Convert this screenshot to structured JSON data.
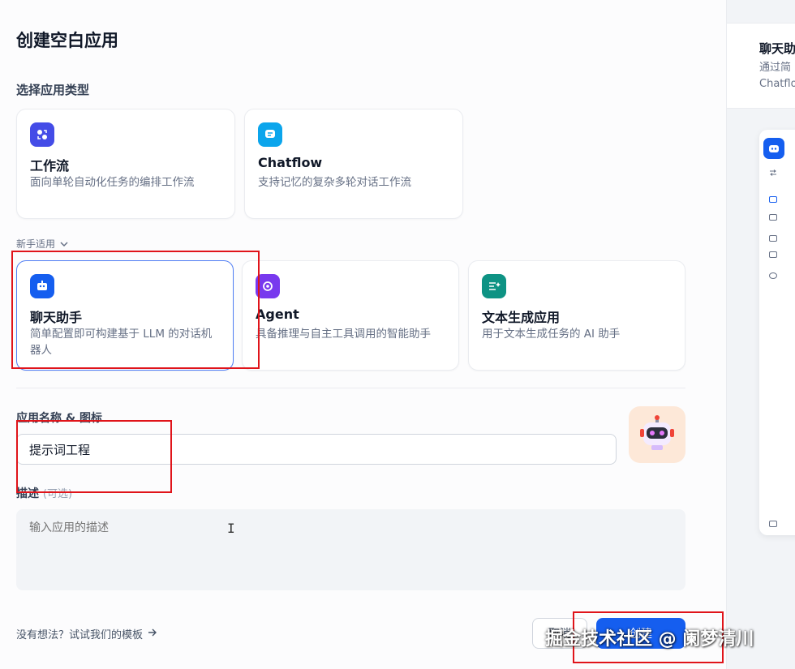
{
  "dialog": {
    "title": "创建空白应用",
    "app_type_label": "选择应用类型"
  },
  "primary_types": [
    {
      "name": "工作流",
      "desc": "面向单轮自动化任务的编排工作流",
      "icon": "workflow-icon",
      "color": "#444ce7"
    },
    {
      "name": "Chatflow",
      "desc": "支持记忆的复杂多轮对话工作流",
      "icon": "chatflow-icon",
      "color": "#0ba5ec"
    }
  ],
  "beginner_toggle": "新手适用",
  "beginner_types": [
    {
      "name": "聊天助手",
      "desc": "简单配置即可构建基于 LLM 的对话机器人",
      "icon": "chat-assistant-icon",
      "color": "#155eef"
    },
    {
      "name": "Agent",
      "desc": "具备推理与自主工具调用的智能助手",
      "icon": "agent-icon",
      "color": "#7839ee"
    },
    {
      "name": "文本生成应用",
      "desc": "用于文本生成任务的 AI 助手",
      "icon": "text-generator-icon",
      "color": "#0e9384"
    }
  ],
  "form": {
    "name_label": "应用名称 & 图标",
    "name_value": "提示词工程",
    "desc_label": "描述",
    "desc_optional": "(可选)",
    "desc_placeholder": "输入应用的描述"
  },
  "footer": {
    "template_link": "没有想法？试试我们的模板",
    "cancel_label": "取消",
    "create_label": "创建"
  },
  "preview": {
    "title": "聊天助手",
    "subtitle_1": "通过简",
    "subtitle_2": "Chatflo"
  },
  "watermark": "掘金技术社区 @ 阑梦清川",
  "colors": {
    "accent": "#155eef",
    "annotation_red": "#e0141a"
  }
}
